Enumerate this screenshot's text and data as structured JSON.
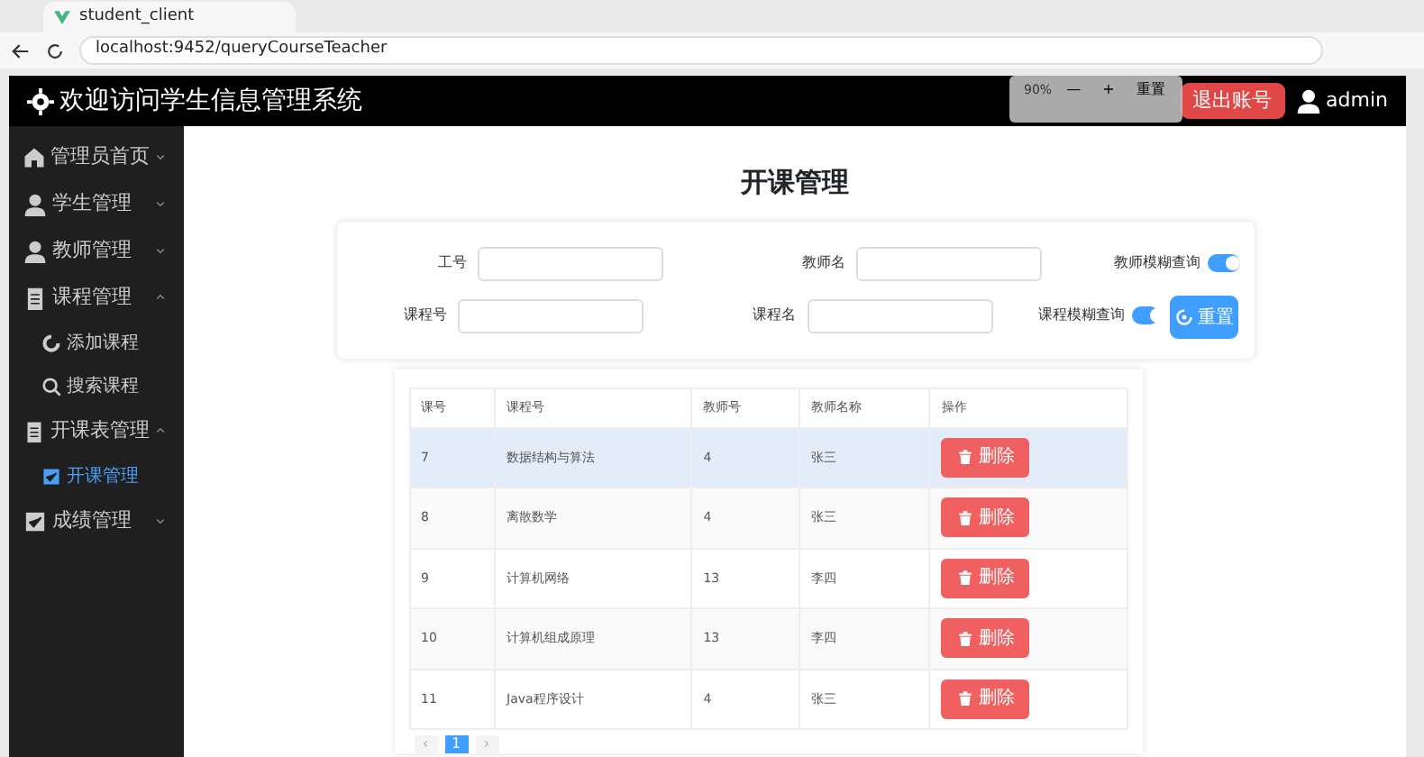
{
  "browser": {
    "tab_title": "student_client",
    "url": "localhost:9452/queryCourseTeacher"
  },
  "header": {
    "title": "欢迎访问学生信息管理系统",
    "logout": "退出账号",
    "user": "admin"
  },
  "zoom_popup": {
    "level": "90%",
    "minus": "—",
    "plus": "+",
    "reset": "重置"
  },
  "sidebar": {
    "items": [
      {
        "label": "管理员首页",
        "expanded": false
      },
      {
        "label": "学生管理",
        "expanded": false
      },
      {
        "label": "教师管理",
        "expanded": false
      },
      {
        "label": "课程管理",
        "expanded": true,
        "children": [
          {
            "label": "添加课程",
            "selected": false
          },
          {
            "label": "搜索课程",
            "selected": false
          }
        ]
      },
      {
        "label": "开课表管理",
        "expanded": true,
        "children": [
          {
            "label": "开课管理",
            "selected": true
          }
        ]
      },
      {
        "label": "成绩管理",
        "expanded": false
      }
    ]
  },
  "page_title": "开课管理",
  "form": {
    "rows": [
      {
        "fields": [
          {
            "label": "工号"
          },
          {
            "label": "教师名"
          }
        ],
        "switch": {
          "label": "教师模糊查询",
          "on": true
        }
      },
      {
        "fields": [
          {
            "label": "课程号"
          },
          {
            "label": "课程名"
          }
        ],
        "switch": {
          "label": "课程模糊查询",
          "on": true
        },
        "button": "重置"
      }
    ]
  },
  "table": {
    "columns": [
      "课号",
      "课程号",
      "教师号",
      "教师名称",
      "操作"
    ],
    "rows": [
      {
        "cells": [
          "7",
          "数据结构与算法",
          "4",
          "张三"
        ],
        "action": "删除",
        "hovered": true
      },
      {
        "cells": [
          "8",
          "离散数学",
          "4",
          "张三"
        ],
        "action": "删除",
        "hovered": false
      },
      {
        "cells": [
          "9",
          "计算机网络",
          "13",
          "李四"
        ],
        "action": "删除",
        "hovered": false
      },
      {
        "cells": [
          "10",
          "计算机组成原理",
          "13",
          "李四"
        ],
        "action": "删除",
        "hovered": false
      },
      {
        "cells": [
          "11",
          "Java程序设计",
          "4",
          "张三"
        ],
        "action": "删除",
        "hovered": false
      }
    ]
  },
  "pagination": {
    "prev": "‹",
    "pages": [
      {
        "label": "1",
        "selected": true
      }
    ],
    "next": "›"
  }
}
